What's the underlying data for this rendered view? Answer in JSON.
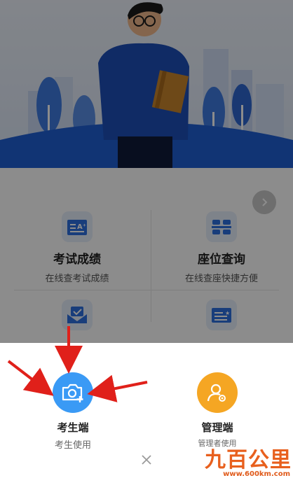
{
  "grid": {
    "items": [
      {
        "title": "考试成绩",
        "subtitle": "在线查考试成绩",
        "icon": "score-icon"
      },
      {
        "title": "座位查询",
        "subtitle": "在线查座快捷方便",
        "icon": "seat-icon"
      },
      {
        "title": "",
        "subtitle": "",
        "icon": "mail-check-icon"
      },
      {
        "title": "",
        "subtitle": "",
        "icon": "card-icon"
      }
    ]
  },
  "sheet": {
    "student": {
      "title": "考生端",
      "subtitle": "考生使用",
      "icon": "camera-plus-icon",
      "color": "#3a9af5"
    },
    "admin": {
      "title": "管理端",
      "subtitle": "管理者使用",
      "icon": "user-settings-icon",
      "color": "#f5a623"
    }
  },
  "watermark": {
    "logo": "九百公里",
    "url": "www.600km.com"
  },
  "colors": {
    "accent_blue": "#3a9af5",
    "accent_orange": "#f5a623",
    "annotation_red": "#e0201a",
    "hero_blue": "#1f5fd3"
  }
}
